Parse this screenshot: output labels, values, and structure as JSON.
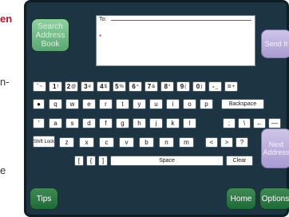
{
  "doc_fragments": [
    {
      "text": "en",
      "style": "red"
    },
    {
      "text": "n-",
      "style": "plain"
    },
    {
      "text": "e",
      "style": "plain"
    }
  ],
  "compose": {
    "to_label": "To:",
    "cursor": "*"
  },
  "buttons": {
    "search_address_book": "Search Address Book",
    "send_it": "Send It",
    "next_address": "Next Address",
    "tips": "Tips",
    "home": "Home",
    "options": "Options"
  },
  "keyboard": {
    "row1": [
      {
        "main": "`",
        "sup": "~"
      },
      {
        "main": "1",
        "sup": "!"
      },
      {
        "main": "2",
        "sup": "@"
      },
      {
        "main": "3",
        "sup": "#"
      },
      {
        "main": "4",
        "sup": "$"
      },
      {
        "main": "5",
        "sup": "%"
      },
      {
        "main": "6",
        "sup": "^"
      },
      {
        "main": "7",
        "sup": "&"
      },
      {
        "main": "8",
        "sup": "*"
      },
      {
        "main": "9",
        "sup": "("
      },
      {
        "main": "0",
        "sup": ")"
      },
      {
        "main": "-",
        "sup": "_"
      },
      {
        "main": "=",
        "sup": "+"
      }
    ],
    "row2": [
      "q",
      "w",
      "e",
      "r",
      "t",
      "y",
      "u",
      "i",
      "o",
      "p"
    ],
    "row2_special": {
      "left": "●",
      "backspace": "Backspace"
    },
    "row3": [
      "a",
      "s",
      "d",
      "f",
      "g",
      "h",
      "j",
      "k",
      "l"
    ],
    "row3_special": {
      "left": "'",
      "semicolon": ";",
      "backslash": "\\",
      "arrow_left": "←",
      "dash": "—"
    },
    "row4": [
      "z",
      "x",
      "c",
      "v",
      "b",
      "n",
      "m"
    ],
    "row4_special": {
      "shift_lock": "Shift Lock",
      "comma": "<",
      "period": ">",
      "slash": "?"
    },
    "row5": {
      "bracket_open": "[",
      "brace": "{",
      "bracket_close": "]",
      "space": "Space",
      "clear": "Clear"
    }
  }
}
